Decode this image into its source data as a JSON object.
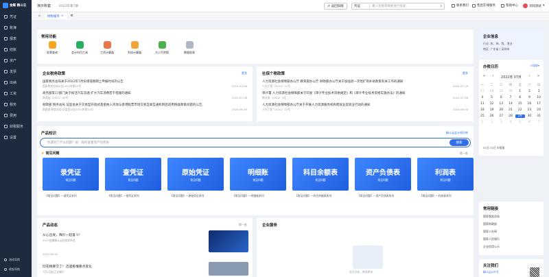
{
  "brand": {
    "name": "金蝶 精斗云"
  },
  "sidebar": {
    "items": [
      {
        "label": "凭证",
        "icon": "voucher-icon"
      },
      {
        "label": "账簿",
        "icon": "ledger-icon"
      },
      {
        "label": "报表",
        "icon": "report-icon"
      },
      {
        "label": "结账",
        "icon": "close-books-icon"
      },
      {
        "label": "资产",
        "icon": "asset-icon"
      },
      {
        "label": "发票",
        "icon": "invoice-icon"
      },
      {
        "label": "出纳",
        "icon": "cashier-icon"
      },
      {
        "label": "工资",
        "icon": "salary-icon"
      },
      {
        "label": "税务",
        "icon": "tax-icon"
      },
      {
        "label": "费用",
        "icon": "expense-icon"
      },
      {
        "label": "财税服务",
        "icon": "service-icon"
      },
      {
        "label": "设置",
        "icon": "settings-icon"
      }
    ],
    "bottom": [
      {
        "label": "流动导航"
      },
      {
        "label": "收起导航"
      }
    ]
  },
  "topbar": {
    "company": "演示账套",
    "period": "2022年第7期",
    "back_label": "返回旧版",
    "search_type": "凭证",
    "search_placeholder": "输入金额或摘要进行搜索",
    "contact": "联系我们",
    "online": "售后在线服务",
    "help": "帮助中心",
    "user": "刘同测试"
  },
  "tabs": [
    {
      "label": "财税服务"
    }
  ],
  "functions": {
    "title": "常用功能",
    "items": [
      {
        "label": "发票查询",
        "color": "#f5a623"
      },
      {
        "label": "会计科目工具",
        "color": "#27ae60"
      },
      {
        "label": "工资计算器",
        "color": "#e8754a"
      },
      {
        "label": "利润计算器",
        "color": "#f2a33a"
      },
      {
        "label": "大小写转换",
        "color": "#4caf50"
      },
      {
        "label": "数据报表",
        "color": "#b0b7c3"
      }
    ]
  },
  "policy": {
    "title": "企业税务政策",
    "more": "更多",
    "items": [
      {
        "title": "国家税务总局关于2022年7月份增值税网上申报时间的公告",
        "sub": "国家税务总局公告2022年第15号",
        "date": "2022-07-08"
      },
      {
        "title": "商务部等17部门关于搞活汽车流通 扩大汽车消费若干措施的通知",
        "sub": "商消函〔2022〕92号",
        "date": "2022-07-08"
      },
      {
        "title": "财政部 税务总局 证监会关于交易型开放式基金纳入内地与香港股票市场交易互联互通机制后适用税收政策问题的公告",
        "sub": "财政部 税务总局 证监会公告2022年第24号",
        "date": "2022-06-30"
      }
    ]
  },
  "social": {
    "title": "社保个税政策",
    "more": "更多",
    "items": [
      {
        "title": "人力资源社会保障部办公厅 教育部办公厅 财政部办公厅关于加强退一次性扩岗补助政策有关工作的通知",
        "sub": "人社厅发〔2022〕41号",
        "date": "2022-07-25"
      },
      {
        "title": "审计署 人力资源社会保障部关于印发《审计专业技术资格规定》和《审计专业技术资格实施办法》的通知",
        "sub": "审计发〔2022〕3号",
        "date": "2022-07-06"
      },
      {
        "title": "人力资源社会保障部办公厅关于开展人力资源服务机构稳就业促就业行动的通知",
        "sub": "人社厅发〔2022〕15号",
        "date": "2022-06-30"
      }
    ]
  },
  "knowledge": {
    "title": "产品知识",
    "link": "精斗云会计知识库",
    "placeholder": "你遇到了什么问题？如：如何查看资产负债表",
    "search_button": "搜索"
  },
  "faq": {
    "title": "常见问题",
    "refresh": "换一批",
    "cards": [
      {
        "title": "录凭证",
        "tag": "常见问题",
        "caption": "【常见问题】一录凭证系列"
      },
      {
        "title": "查凭证",
        "tag": "常见问题",
        "caption": "【常见问题】一查凭证系列"
      },
      {
        "title": "原始凭证",
        "tag": "常见问题",
        "caption": "【常见问题】一原始凭证系列"
      },
      {
        "title": "明细账",
        "tag": "常见问题",
        "caption": "【常见问题】一明细账系列"
      },
      {
        "title": "科目余额表",
        "tag": "常见问题",
        "caption": "【常见问题】一科目余额表系列"
      },
      {
        "title": "资产负债表",
        "tag": "常见问题",
        "caption": "【常见问题】一资产负债表系列"
      },
      {
        "title": "利润表",
        "tag": "常见问题",
        "caption": "【常见问题】一利润表系列"
      }
    ]
  },
  "product_news": {
    "title": "产品动态",
    "refresh": "换一批",
    "items": [
      {
        "title": "从心出发，降价一起奋斗！",
        "sub": "2022金蝶精斗云在线发布会",
        "date": "2022-06-20"
      },
      {
        "title": "印花税要交了！迅速看懂重点变化",
        "sub": "7月1日起正式施行"
      }
    ]
  },
  "enterprise_service": {
    "title": "企业服务",
    "empty": "暂无开放，敬请期待"
  },
  "enterprise_info": {
    "title": "企业信息",
    "industry": "行业: 农、林、牧、渔业",
    "region": "地区: 广东省 / 深圳市"
  },
  "calendar": {
    "title": "办税日历",
    "region": "深圳",
    "month": "2022年 07月",
    "weekdays": [
      "一",
      "二",
      "三",
      "四",
      "五",
      "六",
      "日"
    ],
    "days": [
      "27",
      "28",
      "29",
      "30",
      "1",
      "2",
      "3",
      "4",
      "5",
      "6",
      "7",
      "8",
      "9",
      "10",
      "11",
      "12",
      "13",
      "14",
      "15",
      "16",
      "17",
      "18",
      "19",
      "20",
      "21",
      "22",
      "23",
      "24",
      "25",
      "26",
      "27",
      "28",
      "29",
      "30",
      "31",
      "1",
      "2",
      "3",
      "4",
      "5",
      "6",
      "7"
    ],
    "selected": "29",
    "note": "01日-31日 年报报"
  },
  "links": {
    "title": "常用链接",
    "items": [
      "国家税务总局",
      "国家财政部",
      "国家人社网",
      "国家人民银行",
      "企业信用公示"
    ]
  },
  "follow": {
    "title": "关注我们",
    "wechat": "精斗云公众号"
  }
}
